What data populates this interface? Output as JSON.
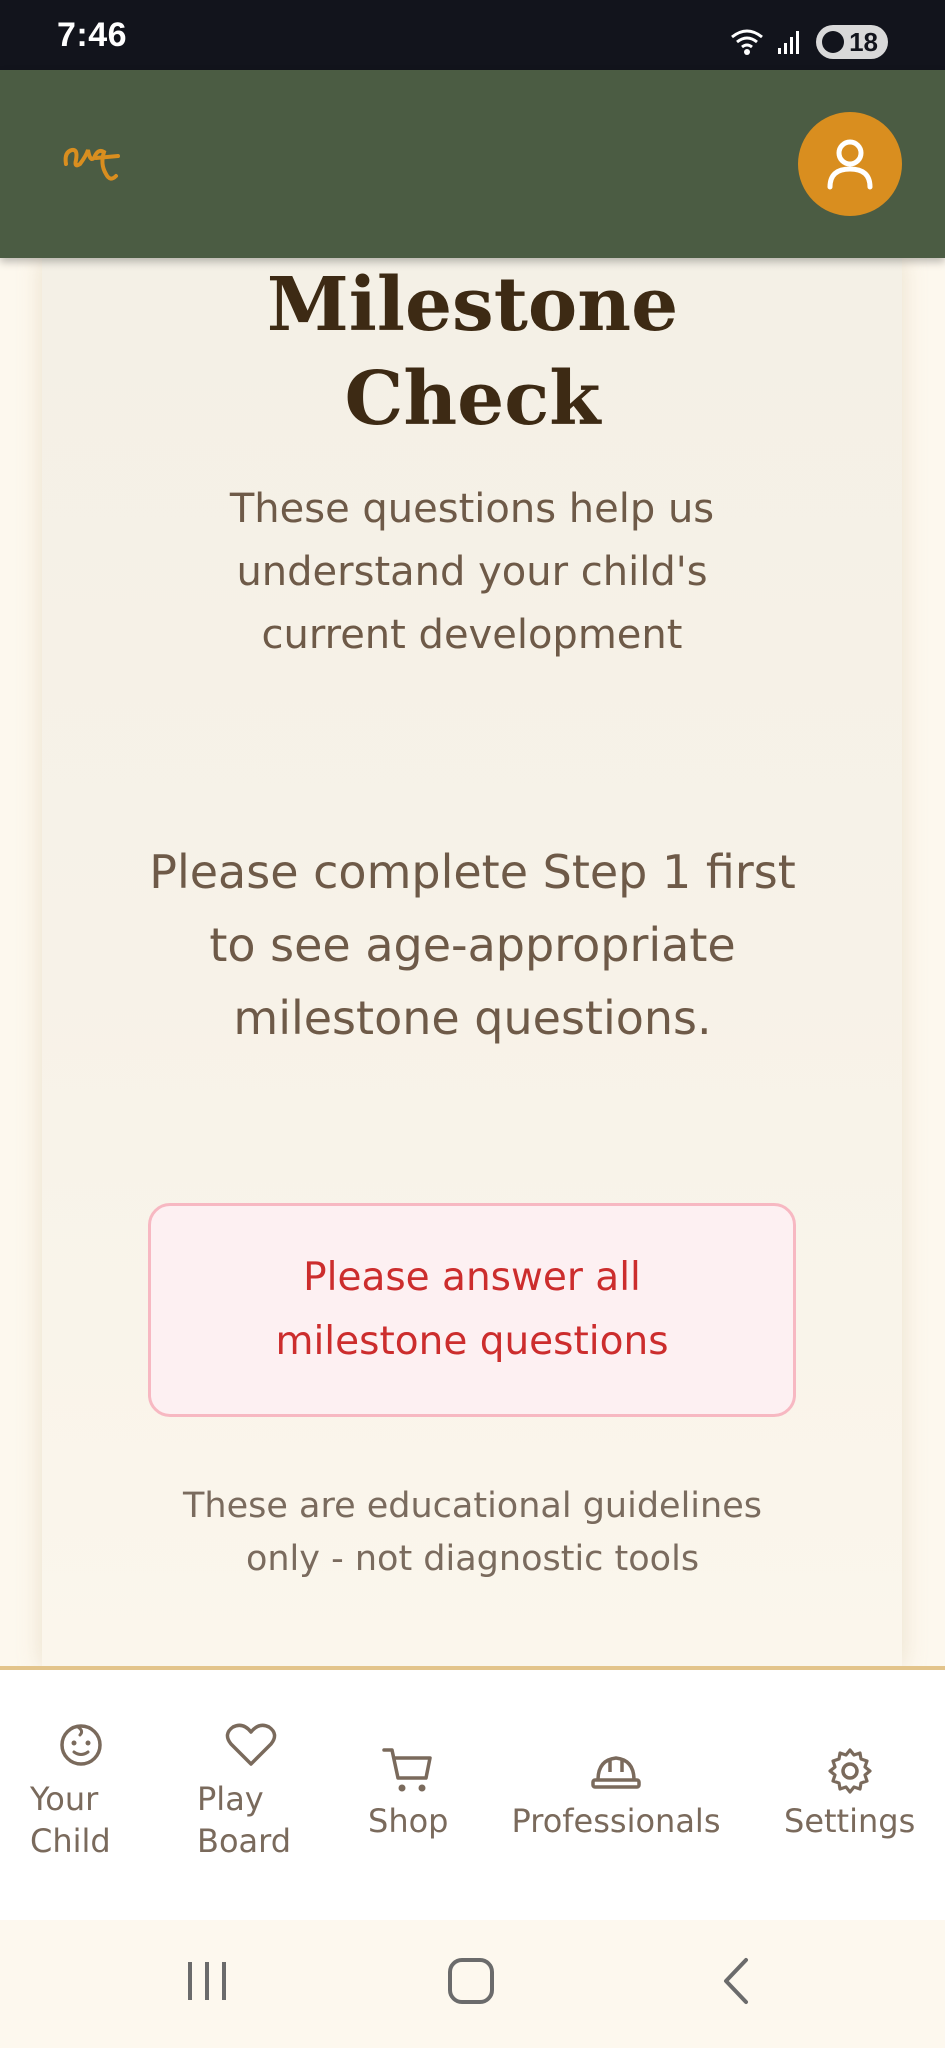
{
  "status_bar": {
    "time": "7:46",
    "battery": "18"
  },
  "header": {
    "logo_icon": "script-logo-icon",
    "profile_icon": "user-icon",
    "accent": "#d98e1f",
    "background": "#4b5c43"
  },
  "main": {
    "title_line1": "Milestone",
    "title_line2": "Check",
    "subtitle": "These questions help us understand your child's current development",
    "step_message": "Please complete Step 1 first to see age-appropriate milestone questions.",
    "error_line1": "Please answer all",
    "error_line2": "milestone questions",
    "disclaimer_line1": "These are educational guidelines",
    "disclaimer_line2": "only - not diagnostic tools"
  },
  "bottom_nav": {
    "items": [
      {
        "label_line1": "Your",
        "label_line2": "Child",
        "icon": "baby-face-icon"
      },
      {
        "label_line1": "Play",
        "label_line2": "Board",
        "icon": "heart-icon"
      },
      {
        "label": "Shop",
        "icon": "cart-icon"
      },
      {
        "label": "Professionals",
        "icon": "hard-hat-icon"
      },
      {
        "label": "Settings",
        "icon": "gear-icon"
      }
    ]
  },
  "colors": {
    "error_text": "#cc2d2d",
    "error_border": "#f7b8c2",
    "title": "#3d2a14"
  }
}
